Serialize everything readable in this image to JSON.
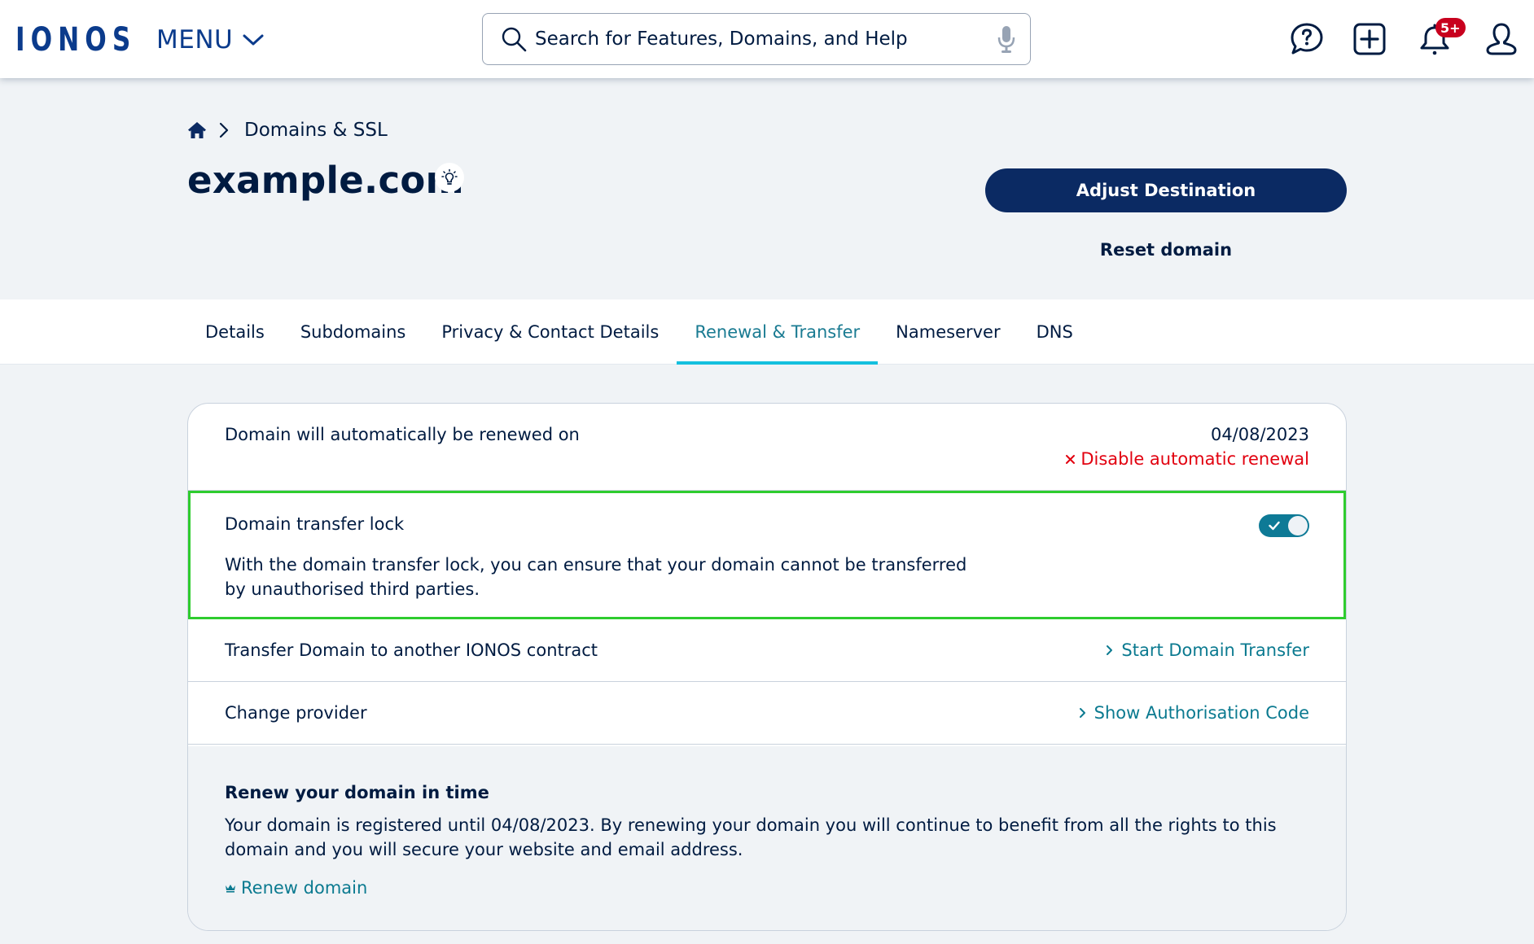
{
  "header": {
    "logo_text": "IONOS",
    "menu_label": "MENU",
    "search": {
      "placeholder": "Search for Features, Domains, and Help",
      "value": ""
    },
    "notifications_badge": "5+",
    "icons": [
      "help-icon",
      "add-icon",
      "bell-icon",
      "user-icon"
    ]
  },
  "breadcrumb": {
    "home_icon": "home-icon",
    "items": [
      "Domains & SSL"
    ]
  },
  "page": {
    "title": "example.com",
    "tip_icon": "lightbulb-icon",
    "primary_button": "Adjust Destination",
    "secondary_button": "Reset domain"
  },
  "tabs": [
    {
      "label": "Details",
      "active": false
    },
    {
      "label": "Subdomains",
      "active": false
    },
    {
      "label": "Privacy & Contact Details",
      "active": false
    },
    {
      "label": "Renewal & Transfer",
      "active": true
    },
    {
      "label": "Nameserver",
      "active": false
    },
    {
      "label": "DNS",
      "active": false
    }
  ],
  "card": {
    "auto_renew": {
      "label": "Domain will automatically be renewed on",
      "date": "04/08/2023",
      "disable_link": "Disable automatic renewal"
    },
    "transfer_lock": {
      "label": "Domain transfer lock",
      "description": "With the domain transfer lock, you can ensure that your domain cannot be transferred by unauthorised third parties.",
      "enabled": true
    },
    "transfer_contract": {
      "label": "Transfer Domain to another IONOS contract",
      "link": "Start Domain Transfer"
    },
    "change_provider": {
      "label": "Change provider",
      "link": "Show Authorisation Code"
    },
    "renew_section": {
      "heading": "Renew your domain in time",
      "text": "Your domain is registered until 04/08/2023. By renewing your domain you will continue to benefit from all the rights to this domain and you will secure your website and email address.",
      "link": "Renew domain"
    }
  },
  "colors": {
    "brand": "#0b3b8c",
    "primary_button": "#0b2a63",
    "link": "#0b7a90",
    "active_tab_underline": "#14c0de",
    "danger": "#e2000f",
    "highlight_border": "#2ecc2e",
    "badge": "#c8001e"
  }
}
